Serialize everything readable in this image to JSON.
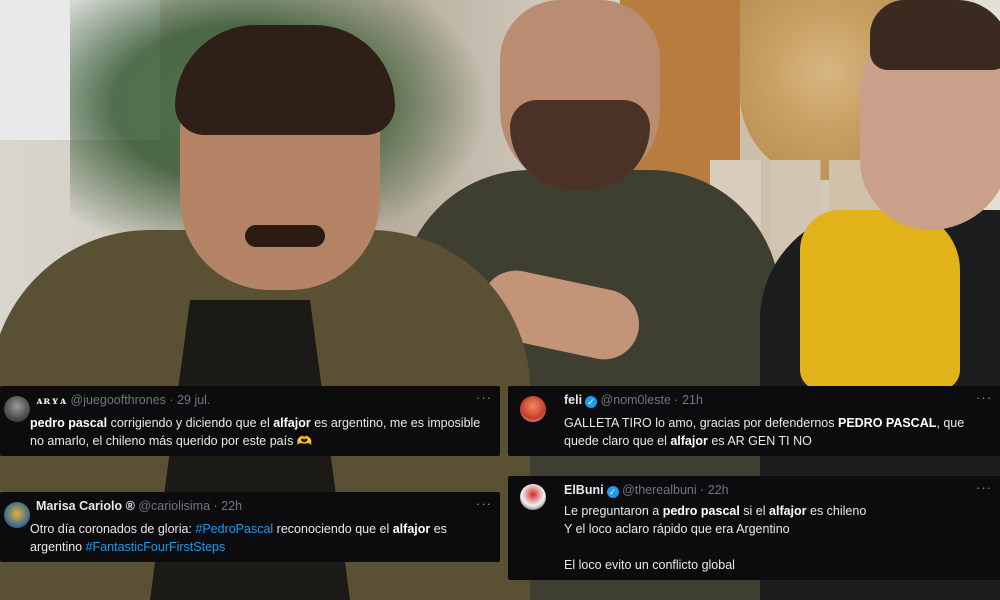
{
  "tweets": [
    {
      "name": "ᴀʀʏᴀ",
      "handle": "@juegoofthrones",
      "time": "29 jul.",
      "body": [
        {
          "t": "pedro pascal",
          "b": true
        },
        {
          "t": " corrigiendo y diciendo que el ",
          "b": false
        },
        {
          "t": "alfajor",
          "b": true
        },
        {
          "t": " es argentino, me es imposible no amarlo, el chileno más querido por este país ",
          "b": false
        }
      ],
      "emoji": "🫶"
    },
    {
      "name": "Marisa Cariolo ®",
      "handle": "@cariolisima",
      "time": "22h",
      "body": [
        {
          "t": "Otro día coronados de gloria: ",
          "b": false
        },
        {
          "t": "#PedroPascal",
          "tag": true
        },
        {
          "t": " reconociendo que el ",
          "b": false
        },
        {
          "t": "alfajor",
          "b": true
        },
        {
          "t": " es argentino ",
          "b": false
        },
        {
          "t": "#FantasticFourFirstSteps",
          "tag": true
        }
      ]
    },
    {
      "name": "feli",
      "handle": "@nom0leste",
      "time": "21h",
      "verified": true,
      "body": [
        {
          "t": "GALLETA TIRO lo amo, gracias por defendernos ",
          "b": false
        },
        {
          "t": "PEDRO PASCAL",
          "b": true
        },
        {
          "t": ", que quede claro que el ",
          "b": false
        },
        {
          "t": "alfajor",
          "b": true
        },
        {
          "t": " es AR GEN TI NO",
          "b": false
        }
      ]
    },
    {
      "name": "ElBuni",
      "handle": "@therealbuni",
      "time": "22h",
      "verified": true,
      "body": [
        {
          "t": "Le preguntaron a ",
          "b": false
        },
        {
          "t": "pedro pascal",
          "b": true
        },
        {
          "t": " si el ",
          "b": false
        },
        {
          "t": "alfajor",
          "b": true
        },
        {
          "t": " es chileno",
          "b": false
        },
        {
          "br": true
        },
        {
          "t": "Y el loco aclaro rápido que era Argentino",
          "b": false
        },
        {
          "br": true
        },
        {
          "br": true
        },
        {
          "t": "El loco evito un conflicto global",
          "b": false
        }
      ]
    }
  ],
  "more_label": "···",
  "verified_glyph": "✓"
}
